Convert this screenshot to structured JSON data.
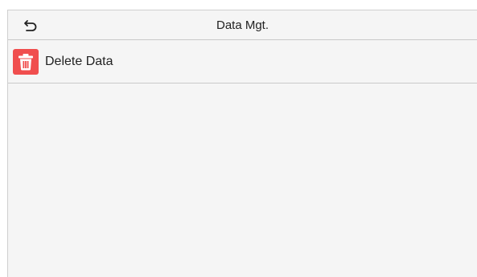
{
  "header": {
    "title": "Data Mgt.",
    "back_icon": "back-arrow-icon"
  },
  "menu": {
    "items": [
      {
        "label": "Delete Data",
        "icon": "trash-icon",
        "icon_color": "#f04e4e"
      }
    ]
  }
}
